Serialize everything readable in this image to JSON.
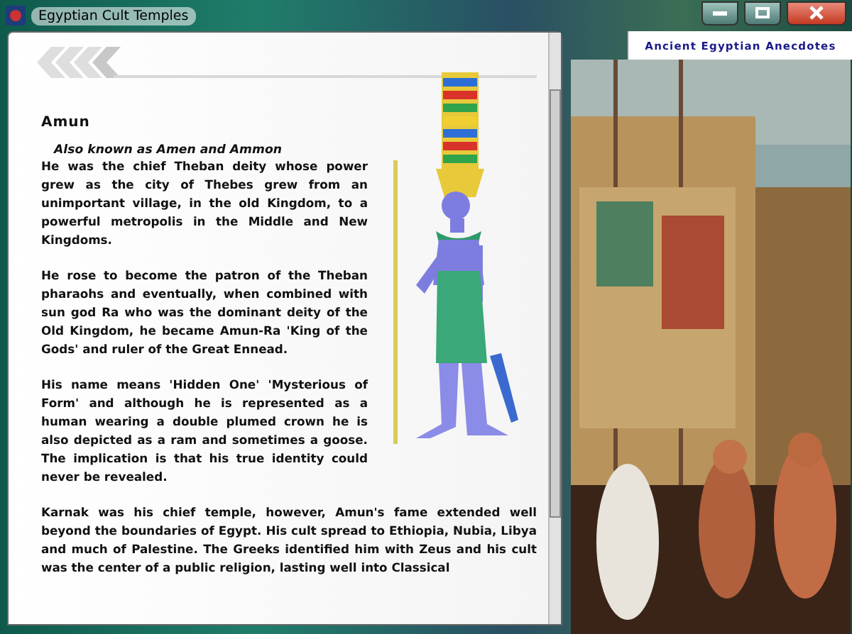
{
  "window": {
    "title": "Egyptian Cult Temples"
  },
  "article": {
    "heading": "Amun",
    "subtitle": "Also known as Amen and Ammon",
    "paragraphs": [
      "He was the chief Theban deity whose power grew as the city of Thebes grew from an unimportant village, in the old Kingdom, to a powerful metropolis in the Middle and New Kingdoms.",
      "He rose to become the patron of the Theban pharaohs and eventually, when combined with sun god Ra who was the dominant deity of the Old Kingdom, he became Amun-Ra 'King of the Gods' and ruler of the Great Ennead.",
      "His name means 'Hidden One' 'Mysterious of Form' and although he is represented as a human wearing a double plumed crown he is also depicted as a ram and sometimes a goose. The implication is that his true identity could never be revealed."
    ],
    "closing_paragraph": "Karnak was his chief temple, however, Amun's fame extended well beyond the boundaries of Egypt. His cult spread to Ethiopia, Nubia, Libya and much of Palestine. The Greeks identified him with Zeus and his cult was the center of a public religion, lasting well into Classical"
  },
  "side_tab": {
    "label": "Ancient Egyptian Anecdotes"
  }
}
